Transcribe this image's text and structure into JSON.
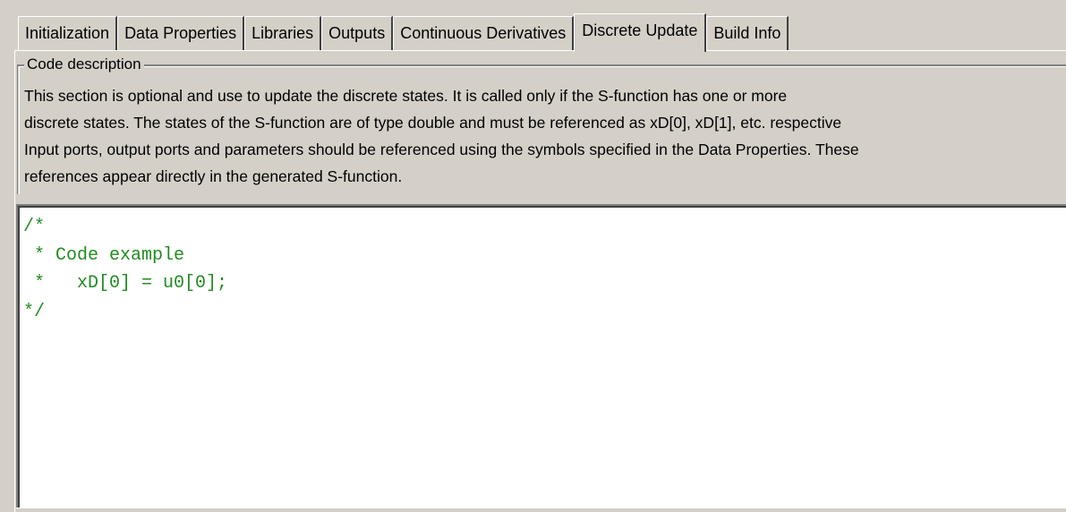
{
  "tabs": [
    {
      "label": "Initialization",
      "active": false
    },
    {
      "label": "Data Properties",
      "active": false
    },
    {
      "label": "Libraries",
      "active": false
    },
    {
      "label": "Outputs",
      "active": false
    },
    {
      "label": "Continuous Derivatives",
      "active": false
    },
    {
      "label": "Discrete Update",
      "active": true
    },
    {
      "label": "Build Info",
      "active": false
    }
  ],
  "description": {
    "legend": "Code description",
    "lines": [
      "This section is optional and use to update the discrete states. It is called only if the S-function has one or more",
      "discrete states. The states of the S-function are of type double and must be referenced as xD[0], xD[1], etc. respective",
      "Input ports, output ports and parameters should be referenced using the symbols specified in the Data Properties. These",
      "references appear directly in the generated S-function."
    ]
  },
  "editor": {
    "code_color": "#228b22",
    "lines": [
      "/*",
      " * Code example",
      " *   xD[0] = u0[0];",
      "*/"
    ]
  }
}
